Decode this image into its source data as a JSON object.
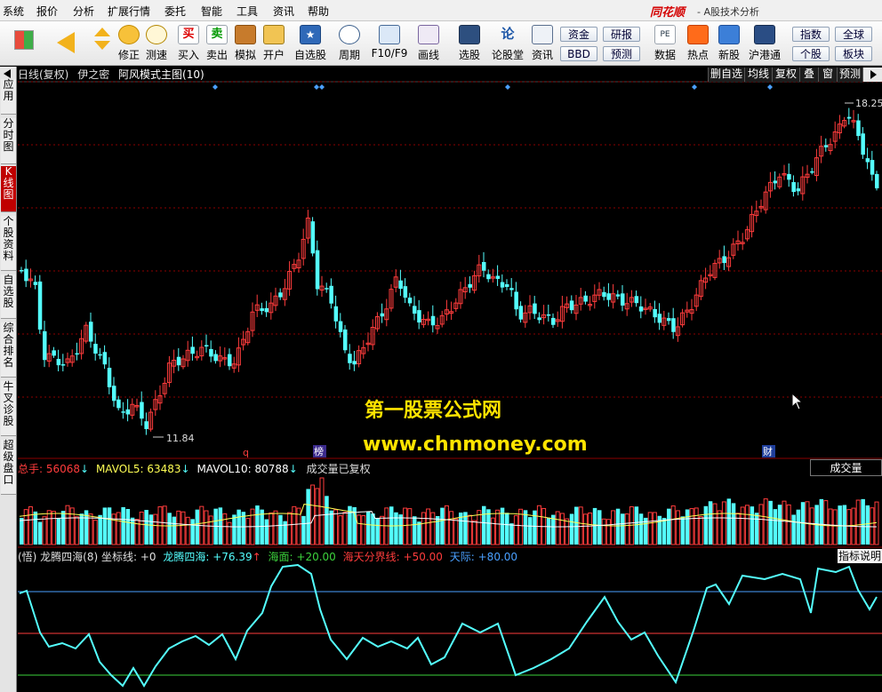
{
  "menu": [
    "系统",
    "报价",
    "分析",
    "扩展行情",
    "委托",
    "智能",
    "工具",
    "资讯",
    "帮助"
  ],
  "brand": {
    "name": "同花顺",
    "subtitle": "- A股技术分析"
  },
  "toolbar": {
    "buttons": [
      "修正",
      "测速",
      "买入",
      "卖出",
      "模拟",
      "开户",
      "自选股",
      "周期",
      "F10/F9",
      "画线",
      "选股",
      "论股堂",
      "资讯",
      "数据",
      "热点",
      "新股",
      "沪港通"
    ],
    "small": [
      "资金",
      "研报",
      "BBD",
      "预测",
      "指数",
      "全球",
      "个股",
      "板块"
    ]
  },
  "sidebar": [
    "应用",
    "分时图",
    "K线图",
    "个股资料",
    "自选股",
    "综合排名",
    "牛叉诊股",
    "超级盘口"
  ],
  "chart_header": {
    "period": "日线(复权)",
    "formula": "伊之密",
    "main": "阿风模式主图(10)"
  },
  "right_buttons": [
    "删自选",
    "均线",
    "复权",
    "叠",
    "窗",
    "预测"
  ],
  "price_labels": {
    "high": "18.25",
    "low": "11.84"
  },
  "markers": {
    "q": "q",
    "bang": "榜",
    "cai": "财"
  },
  "volume": {
    "total_label": "总手: ",
    "total": "56068",
    "ma5_label": "MAVOL5: ",
    "ma5": "63483",
    "ma10_label": "MAVOL10: ",
    "ma10": "80788",
    "note": "成交量已复权",
    "box": "成交量"
  },
  "indicator": {
    "name": "(悟) 龙腾四海(8) 坐标线: +0",
    "longteng_label": "龙腾四海: ",
    "longteng": "+76.39",
    "haimian_label": "海面: ",
    "haimian": "+20.00",
    "haitian_label": "海天分界线: ",
    "haitian": "+50.00",
    "tianji_label": "天际: ",
    "tianji": "+80.00",
    "box": "指标说明"
  },
  "watermark": {
    "line1": "第一股票公式网",
    "line2": "www.chnmoney.com"
  },
  "colors": {
    "up": "#ff3c3c",
    "down": "#54ffff",
    "grid": "#8b0000",
    "indicator": "#54ffff"
  }
}
